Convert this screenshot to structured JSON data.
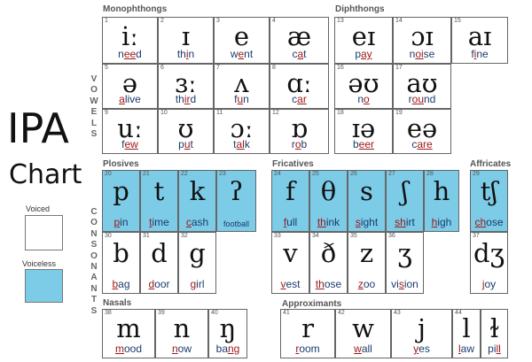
{
  "title": "IPA",
  "subtitle": "Chart",
  "vowels_label": "VOWELS",
  "consonants_label": "CONSONANTS",
  "legend": {
    "voiced": "Voiced",
    "voiceless": "Voiceless",
    "voiced_color": "#ffffff",
    "voiceless_color": "#7ccbe7"
  },
  "sections": {
    "monophthongs": "Monophthongs",
    "diphthongs": "Diphthongs",
    "plosives": "Plosives",
    "fricatives": "Fricatives",
    "affricates": "Affricates",
    "nasals": "Nasals",
    "approximants": "Approximants"
  },
  "cells": [
    {
      "n": "1",
      "sym": "iː",
      "pre": "n",
      "hl": "ee",
      "post": "d"
    },
    {
      "n": "2",
      "sym": "ɪ",
      "pre": "th",
      "hl": "i",
      "post": "n"
    },
    {
      "n": "3",
      "sym": "e",
      "pre": "w",
      "hl": "e",
      "post": "nt"
    },
    {
      "n": "4",
      "sym": "æ",
      "pre": "c",
      "hl": "a",
      "post": "t"
    },
    {
      "n": "5",
      "sym": "ə",
      "pre": "",
      "hl": "a",
      "post": "live"
    },
    {
      "n": "6",
      "sym": "ɜː",
      "pre": "th",
      "hl": "ir",
      "post": "d"
    },
    {
      "n": "7",
      "sym": "ʌ",
      "pre": "f",
      "hl": "u",
      "post": "n"
    },
    {
      "n": "8",
      "sym": "ɑː",
      "pre": "c",
      "hl": "ar",
      "post": ""
    },
    {
      "n": "9",
      "sym": "uː",
      "pre": "f",
      "hl": "ew",
      "post": ""
    },
    {
      "n": "10",
      "sym": "ʊ",
      "pre": "p",
      "hl": "u",
      "post": "t"
    },
    {
      "n": "11",
      "sym": "ɔː",
      "pre": "t",
      "hl": "al",
      "post": "k"
    },
    {
      "n": "12",
      "sym": "ɒ",
      "pre": "r",
      "hl": "o",
      "post": "b"
    },
    {
      "n": "13",
      "sym": "eɪ",
      "pre": "p",
      "hl": "ay",
      "post": ""
    },
    {
      "n": "14",
      "sym": "ɔɪ",
      "pre": "n",
      "hl": "oi",
      "post": "se"
    },
    {
      "n": "15",
      "sym": "aɪ",
      "pre": "f",
      "hl": "i",
      "post": "ne"
    },
    {
      "n": "16",
      "sym": "əʊ",
      "pre": "n",
      "hl": "o",
      "post": ""
    },
    {
      "n": "17",
      "sym": "aʊ",
      "pre": "r",
      "hl": "ou",
      "post": "nd"
    },
    {
      "n": "18",
      "sym": "ɪə",
      "pre": "b",
      "hl": "eer",
      "post": ""
    },
    {
      "n": "19",
      "sym": "eə",
      "pre": "c",
      "hl": "are",
      "post": ""
    },
    {
      "n": "20",
      "sym": "p",
      "pre": "",
      "hl": "p",
      "post": "in"
    },
    {
      "n": "21",
      "sym": "t",
      "pre": "",
      "hl": "t",
      "post": "ime"
    },
    {
      "n": "22",
      "sym": "k",
      "pre": "",
      "hl": "c",
      "post": "ash"
    },
    {
      "n": "23",
      "sym": "ʔ",
      "pre": "football",
      "hl": "",
      "post": ""
    },
    {
      "n": "24",
      "sym": "f",
      "pre": "",
      "hl": "f",
      "post": "ull"
    },
    {
      "n": "25",
      "sym": "θ",
      "pre": "",
      "hl": "th",
      "post": "ink"
    },
    {
      "n": "26",
      "sym": "s",
      "pre": "",
      "hl": "s",
      "post": "ight"
    },
    {
      "n": "27",
      "sym": "ʃ",
      "pre": "",
      "hl": "sh",
      "post": "irt"
    },
    {
      "n": "28",
      "sym": "h",
      "pre": "",
      "hl": "h",
      "post": "igh"
    },
    {
      "n": "29",
      "sym": "tʃ",
      "pre": "",
      "hl": "ch",
      "post": "ose"
    },
    {
      "n": "30",
      "sym": "b",
      "pre": "",
      "hl": "b",
      "post": "ag"
    },
    {
      "n": "31",
      "sym": "d",
      "pre": "",
      "hl": "d",
      "post": "oor"
    },
    {
      "n": "32",
      "sym": "g",
      "pre": "",
      "hl": "g",
      "post": "irl"
    },
    {
      "n": "33",
      "sym": "v",
      "pre": "",
      "hl": "v",
      "post": "est"
    },
    {
      "n": "34",
      "sym": "ð",
      "pre": "",
      "hl": "th",
      "post": "ose"
    },
    {
      "n": "35",
      "sym": "z",
      "pre": "",
      "hl": "z",
      "post": "oo"
    },
    {
      "n": "36",
      "sym": "ʒ",
      "pre": "vi",
      "hl": "s",
      "post": "ion"
    },
    {
      "n": "37",
      "sym": "dʒ",
      "pre": "",
      "hl": "j",
      "post": "oy"
    },
    {
      "n": "38",
      "sym": "m",
      "pre": "",
      "hl": "m",
      "post": "ood"
    },
    {
      "n": "39",
      "sym": "n",
      "pre": "",
      "hl": "n",
      "post": "ow"
    },
    {
      "n": "40",
      "sym": "ŋ",
      "pre": "ba",
      "hl": "ng",
      "post": ""
    },
    {
      "n": "41",
      "sym": "r",
      "pre": "",
      "hl": "r",
      "post": "oom"
    },
    {
      "n": "42",
      "sym": "w",
      "pre": "",
      "hl": "w",
      "post": "all"
    },
    {
      "n": "43",
      "sym": "j",
      "pre": "",
      "hl": "y",
      "post": "es"
    },
    {
      "n": "44a",
      "sym": "l",
      "pre": "",
      "hl": "l",
      "post": "aw"
    },
    {
      "n": "44b",
      "sym": "ɫ",
      "pre": "pi",
      "hl": "ll",
      "post": ""
    }
  ]
}
